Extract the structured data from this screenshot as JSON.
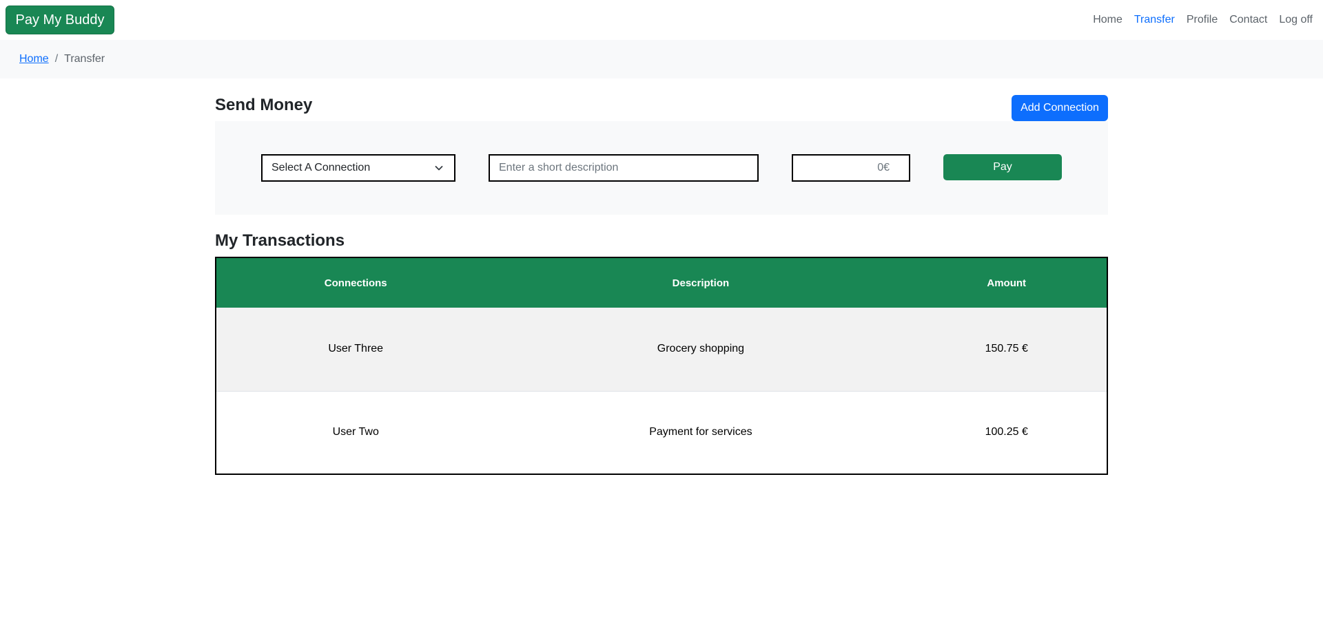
{
  "navbar": {
    "brand": "Pay My Buddy",
    "links": [
      "Home",
      "Transfer",
      "Profile",
      "Contact",
      "Log off"
    ],
    "active": "Transfer"
  },
  "breadcrumb": {
    "home": "Home",
    "separator": "/",
    "current": "Transfer"
  },
  "send_money": {
    "title": "Send Money",
    "add_connection_label": "Add Connection",
    "connection_select": "Select A Connection",
    "description_placeholder": "Enter a short description",
    "amount_value": "0€",
    "pay_label": "Pay"
  },
  "transactions": {
    "title": "My Transactions",
    "headers": [
      "Connections",
      "Description",
      "Amount"
    ],
    "rows": [
      [
        "User Three",
        "Grocery shopping",
        "150.75 €"
      ],
      [
        "User Two",
        "Payment for services",
        "100.25 €"
      ]
    ]
  },
  "colors": {
    "brand_green": "#198754",
    "primary_blue": "#0d6efd",
    "panel_bg": "#f8f9fa"
  },
  "icons": {
    "select_arrow": "chevron-down-icon"
  }
}
